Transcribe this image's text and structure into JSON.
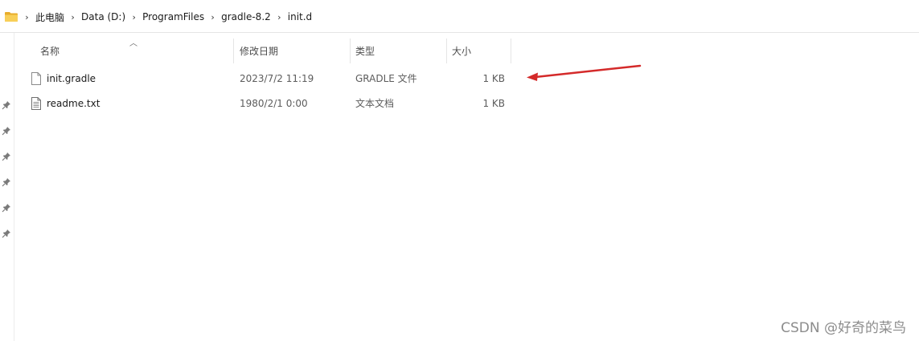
{
  "breadcrumb": {
    "items": [
      "此电脑",
      "Data (D:)",
      "ProgramFiles",
      "gradle-8.2",
      "init.d"
    ],
    "separator": "›"
  },
  "columns": {
    "name": "名称",
    "date": "修改日期",
    "type": "类型",
    "size": "大小"
  },
  "files": [
    {
      "name": "init.gradle",
      "date": "2023/7/2 11:19",
      "type": "GRADLE 文件",
      "size": "1 KB"
    },
    {
      "name": "readme.txt",
      "date": "1980/2/1 0:00",
      "type": "文本文档",
      "size": "1 KB"
    }
  ],
  "icons": {
    "folder": "folder-icon",
    "pin": "pin-icon",
    "file": "file-icon",
    "sort": "sort-ascending-icon"
  },
  "colors": {
    "annotation_arrow": "#d42a2a",
    "folder": "#f4c542"
  },
  "watermark": "CSDN @好奇的菜鸟"
}
